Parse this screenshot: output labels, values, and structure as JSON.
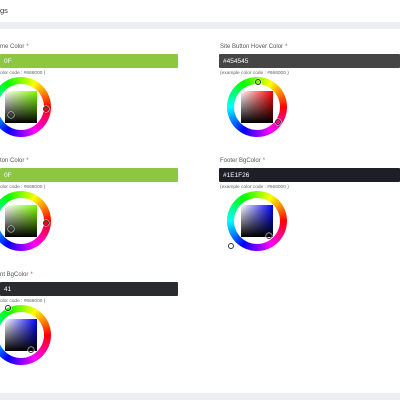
{
  "page": {
    "title": "gs"
  },
  "fields": {
    "theme_color": {
      "label": "me Color",
      "value": "0F",
      "hint": "olor code : #666000 )"
    },
    "button_color": {
      "label": "ton Color",
      "value": "0F",
      "hint": "olor code : #666000 )"
    },
    "text_bgcolor": {
      "label": "nt BgColor",
      "value": "41",
      "hint": "olor code : #666000 )"
    },
    "button_hover_color": {
      "label": "Site Button Hover Color",
      "value": "#454545",
      "hint": "(example color code : #666000 )"
    },
    "footer_bgcolor": {
      "label": "Footer BgColor",
      "value": "#1E1F26",
      "hint": "(example color code : #666000 )"
    }
  },
  "colors": {
    "green": "#8dc63f",
    "dark_gray": "#454545",
    "footer": "#1e1f26",
    "text_bg": "#2a2b2f",
    "hue_green": "#7fff00",
    "hue_red": "#ff0000",
    "hue_blue": "#0000ff",
    "required": "#e0434d"
  }
}
